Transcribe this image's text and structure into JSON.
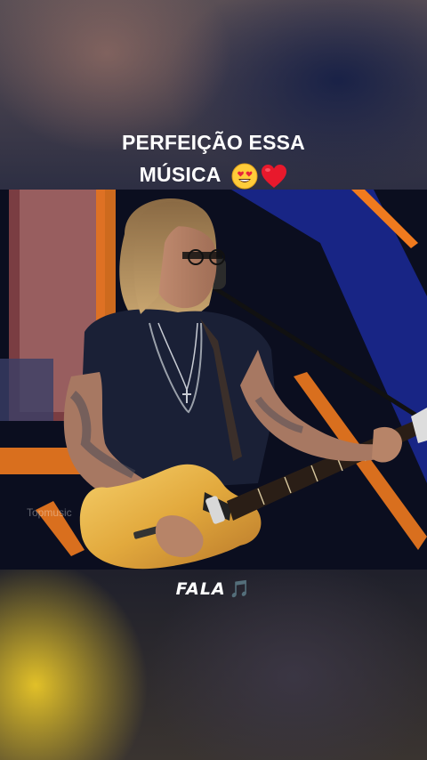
{
  "caption": {
    "line1": "PERFEIÇÃO ESSA",
    "line2": "MÚSICA",
    "emojis": [
      "heart-eyes-face",
      "red-heart"
    ]
  },
  "video": {
    "watermark": "Topmusic"
  },
  "footer": {
    "label": "FALA",
    "note": "🎵"
  },
  "colors": {
    "stage_orange": "#f07a1e",
    "stage_blue": "#1d2ea8",
    "guitar_gold": "#e9b84a",
    "shirt": "#1a2036"
  }
}
